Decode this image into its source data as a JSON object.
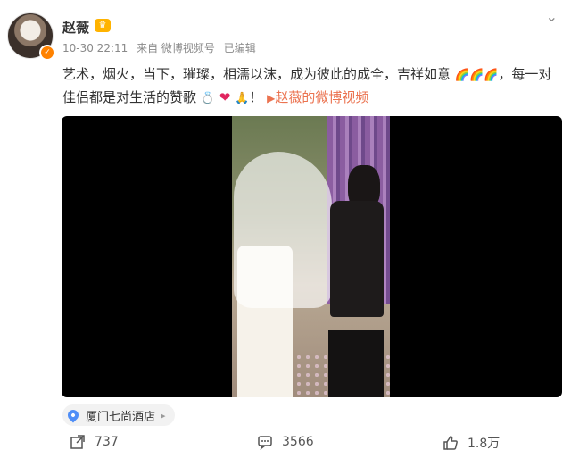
{
  "author": {
    "name": "赵薇"
  },
  "meta": {
    "time": "10-30 22:11",
    "source": "来自 微博视频号",
    "edited": "已编辑"
  },
  "post": {
    "text_main": "艺术，烟火，当下，璀璨，相濡以沫，成为彼此的成全，吉祥如意",
    "text_cont1": "，每一对佳侣都是对生活的赞歌",
    "text_end": "！",
    "link": "赵薇的微博视频"
  },
  "location": {
    "name": "厦门七尚酒店"
  },
  "actions": {
    "reposts": "737",
    "comments": "3566",
    "likes": "1.8万"
  },
  "icons": [
    "more-icon",
    "crown-badge",
    "verified-icon",
    "rainbow-emoji",
    "ring-emoji",
    "heart-emoji",
    "pray-emoji",
    "video-icon",
    "pin-icon",
    "repost-icon",
    "comment-icon",
    "like-icon"
  ],
  "colors": {
    "link": "#eb7350",
    "verified": "#ff8200",
    "pin": "#4f8ef7"
  }
}
